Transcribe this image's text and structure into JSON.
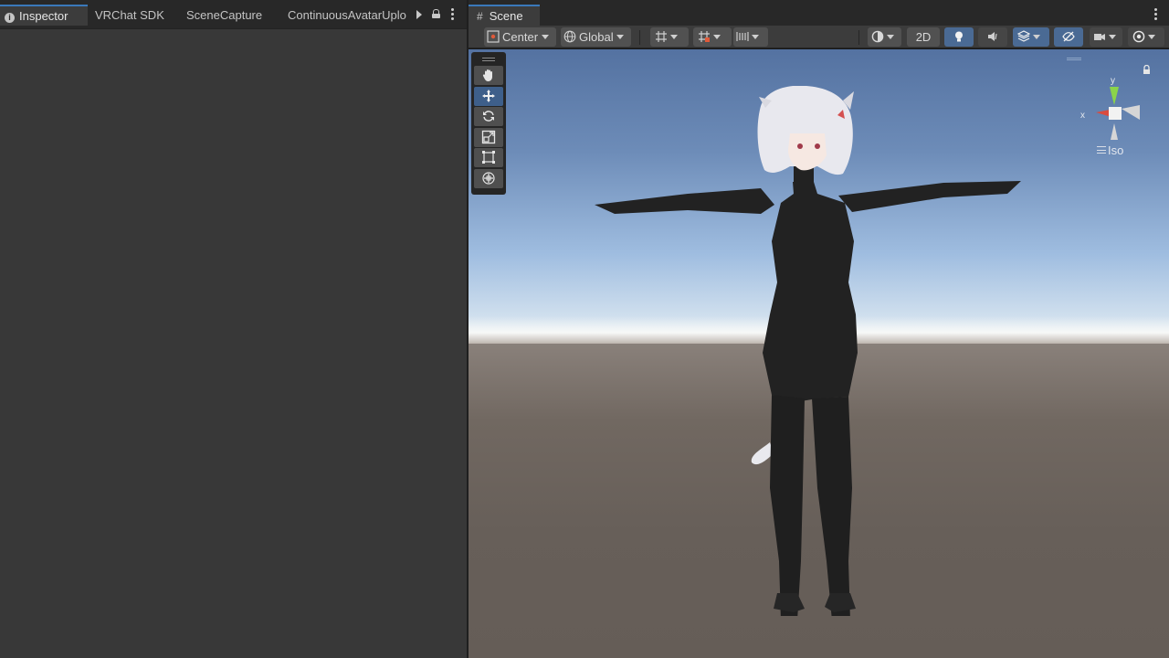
{
  "left_panel": {
    "tabs": [
      {
        "label": "Inspector",
        "active": true
      },
      {
        "label": "VRChat SDK",
        "active": false
      },
      {
        "label": "SceneCapture",
        "active": false
      },
      {
        "label": "ContinuousAvatarUploader",
        "active": false
      }
    ],
    "tab_overflow_label": "ContinuousAvatarUplo"
  },
  "scene_panel": {
    "tab": {
      "label": "Scene",
      "icon": "grid-hash-icon"
    },
    "toolbar": {
      "pivot_mode": "Center",
      "pivot_rotation": "Global",
      "mode_2d": "2D",
      "icons": [
        "grid-snap-icon",
        "increment-snap-icon",
        "align-icon",
        "draw-mode-icon",
        "lighting-icon",
        "audio-icon",
        "effects-icon",
        "visibility-icon",
        "camera-icon",
        "gizmos-icon"
      ]
    },
    "tools": [
      "hand-tool",
      "move-tool",
      "rotate-tool",
      "scale-tool",
      "rect-tool",
      "transform-tool"
    ],
    "active_tool": "move-tool",
    "gizmo": {
      "projection": "Iso",
      "axes": {
        "x": "x",
        "y": "y"
      }
    }
  },
  "colors": {
    "accent": "#3a79bb",
    "panel_bg": "#383838",
    "tabbar_bg": "#282828",
    "active_button": "#4a6a94",
    "axis_x": "#d94b3f",
    "axis_y": "#8bd44a"
  }
}
